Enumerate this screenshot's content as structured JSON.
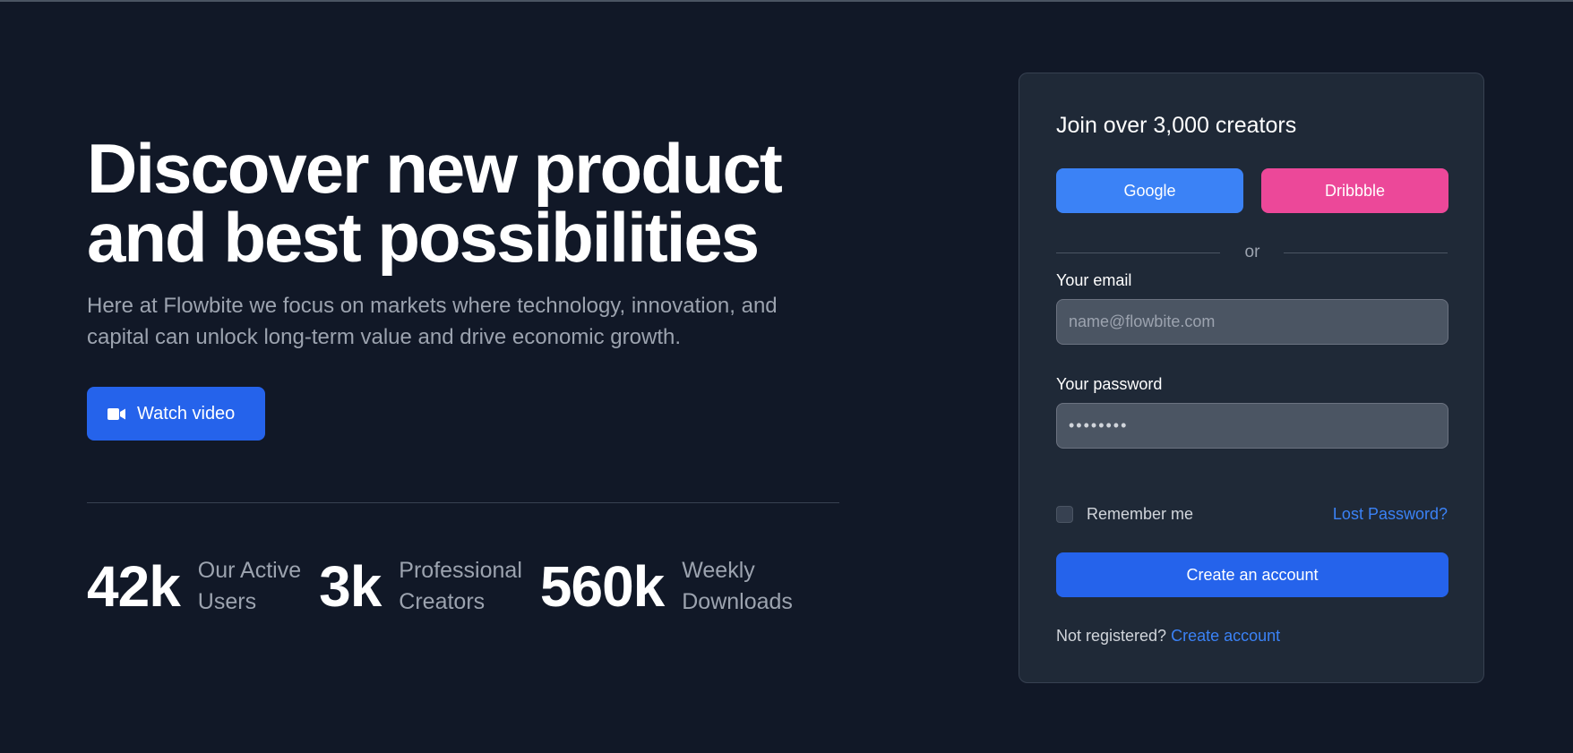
{
  "hero": {
    "headline_line1": "Discover new product",
    "headline_line2": "and best possibilities",
    "subtext": "Here at Flowbite we focus on markets where technology, innovation, and capital can unlock long-term value and drive economic growth.",
    "watch_button_label": "Watch video",
    "watch_icon": "video-camera-icon"
  },
  "stats": [
    {
      "value": "42k",
      "label_line1": "Our Active",
      "label_line2": "Users"
    },
    {
      "value": "3k",
      "label_line1": "Professional",
      "label_line2": "Creators"
    },
    {
      "value": "560k",
      "label_line1": "Weekly",
      "label_line2": "Downloads"
    }
  ],
  "signup": {
    "title": "Join over 3,000 creators",
    "google_label": "Google",
    "dribbble_label": "Dribbble",
    "or_text": "or",
    "email_label": "Your email",
    "email_placeholder": "name@flowbite.com",
    "email_value": "",
    "password_label": "Your password",
    "password_value": "••••••••",
    "remember_label": "Remember me",
    "lost_password_label": "Lost Password?",
    "create_button_label": "Create an account",
    "not_registered_text": "Not registered?",
    "create_link_label": "Create account"
  },
  "colors": {
    "background": "#111827",
    "card": "#1f2937",
    "primary": "#2563eb",
    "google": "#3b82f6",
    "dribbble": "#ec4899",
    "link": "#3b82f6"
  }
}
